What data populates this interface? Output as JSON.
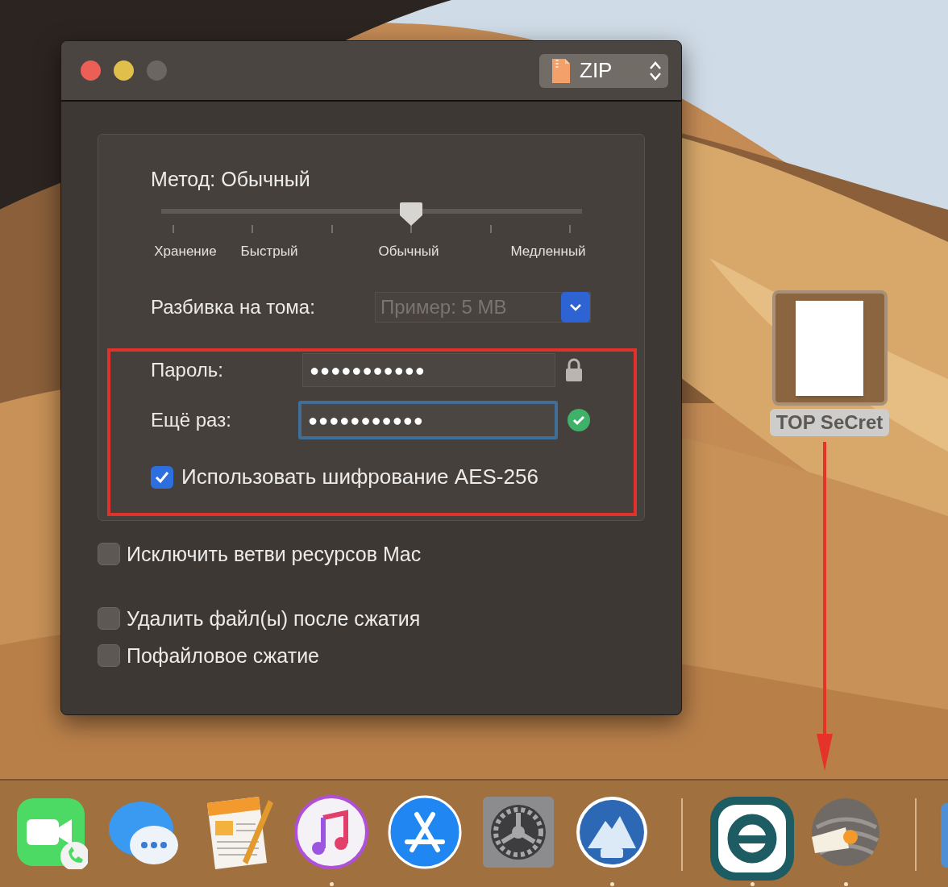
{
  "window": {
    "traffic_lights": [
      {
        "color": "#ec5f57"
      },
      {
        "color": "#e0c04a"
      },
      {
        "color": "#6b6662"
      }
    ],
    "format_popup": {
      "label": "ZIP"
    }
  },
  "method": {
    "label": "Метод: Обычный",
    "level": 0.6,
    "tick_labels": [
      "Хранение",
      "Быстрый",
      "Обычный",
      "Медленный"
    ]
  },
  "split": {
    "label": "Разбивка на тома:",
    "placeholder": "Пример: 5 MB"
  },
  "password": {
    "label": "Пароль:",
    "value": "●●●●●●●●●●●",
    "focused": false
  },
  "repeat": {
    "label": "Ещё раз:",
    "value": "●●●●●●●●●●●",
    "focused": true,
    "match": true
  },
  "aes": {
    "label": "Использовать шифрование AES-256",
    "checked": true
  },
  "options": [
    {
      "label": "Исключить ветви ресурсов Mac",
      "checked": false
    },
    {
      "label": "Удалить файл(ы) после сжатия",
      "checked": false
    },
    {
      "label": "Пофайловое сжатие",
      "checked": false
    }
  ],
  "desktop_file": {
    "name": "TOP SeCret",
    "selected": true
  },
  "dock": [
    {
      "kind": "facetime",
      "running": false
    },
    {
      "kind": "messages",
      "running": false
    },
    {
      "kind": "pages",
      "running": false
    },
    {
      "kind": "music",
      "running": true
    },
    {
      "kind": "appstore",
      "running": false
    },
    {
      "kind": "settings",
      "running": false
    },
    {
      "kind": "vpn",
      "running": true
    },
    {
      "kind": "separator"
    },
    {
      "kind": "eset",
      "running": true
    },
    {
      "kind": "archiver",
      "running": true
    },
    {
      "kind": "separator"
    },
    {
      "kind": "partial",
      "running": false
    }
  ]
}
